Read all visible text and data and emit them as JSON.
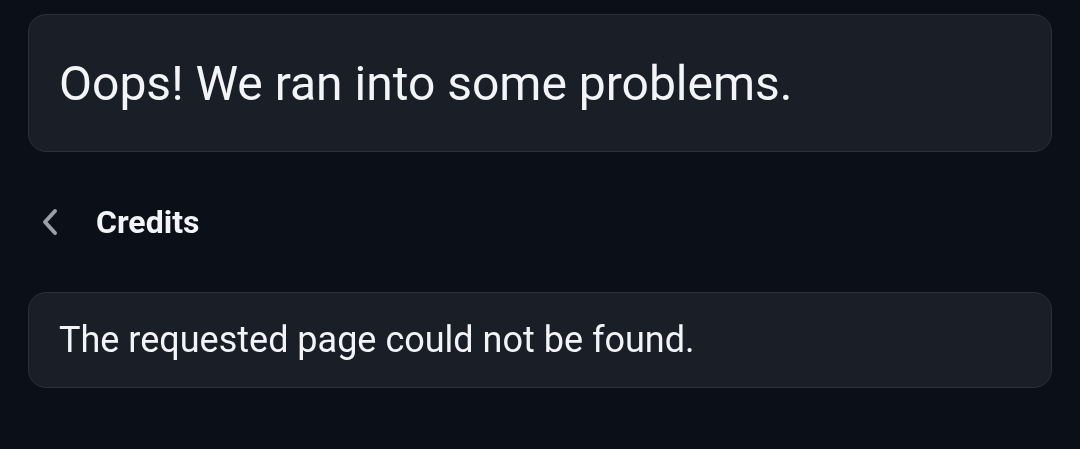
{
  "error_banner": {
    "title": "Oops! We ran into some problems."
  },
  "header": {
    "back": true,
    "title": "Credits"
  },
  "message": {
    "text": "The requested page could not be found."
  }
}
